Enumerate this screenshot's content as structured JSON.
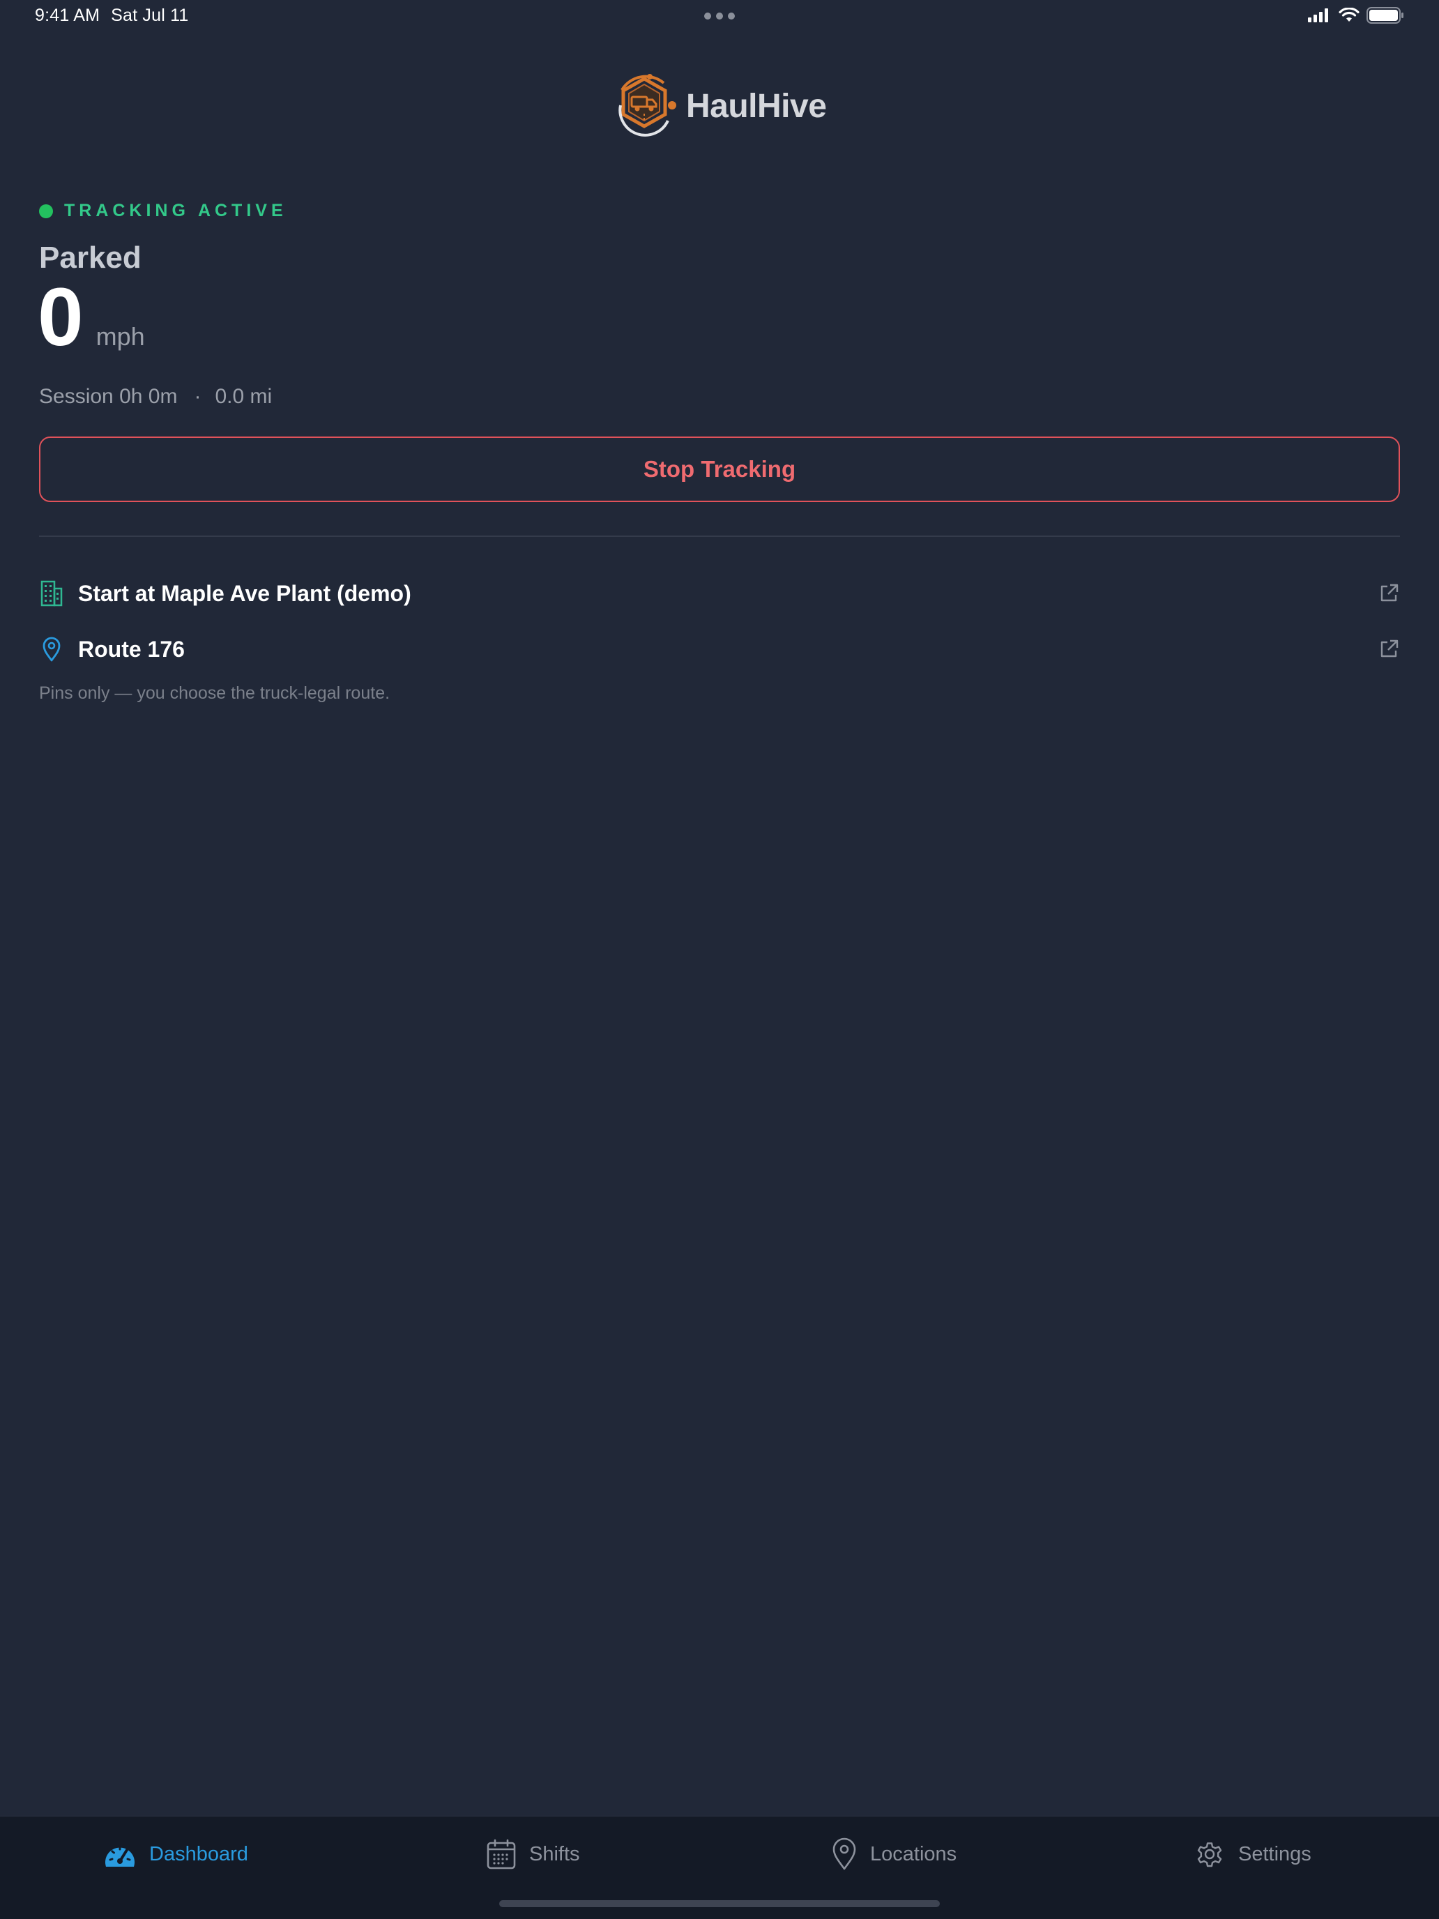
{
  "status_bar": {
    "time": "9:41 AM",
    "date": "Sat Jul 11",
    "icons": [
      "signal-icon",
      "wifi-icon",
      "battery-icon"
    ]
  },
  "brand": {
    "name": "HaulHive",
    "accent_color": "#d8782c"
  },
  "tracking": {
    "status_label": "TRACKING ACTIVE",
    "status_color": "#33c98a",
    "state": "Parked",
    "speed": "0",
    "speed_unit": "mph",
    "session_label": "Session 0h 0m",
    "separator": "·",
    "distance": "0.0 mi",
    "stop_button_label": "Stop Tracking",
    "stop_button_color": "#ef6b70"
  },
  "destinations": {
    "items": [
      {
        "icon": "building-icon",
        "label": "Start at Maple Ave Plant (demo)",
        "action_icon": "external-link-icon"
      },
      {
        "icon": "map-pin-icon",
        "label": "Route 176",
        "action_icon": "external-link-icon"
      }
    ],
    "hint": "Pins only — you choose the truck-legal route."
  },
  "tab_bar": {
    "active_color": "#2a9bdf",
    "tabs": [
      {
        "label": "Dashboard",
        "icon": "speedometer-icon",
        "active": true
      },
      {
        "label": "Shifts",
        "icon": "calendar-icon",
        "active": false
      },
      {
        "label": "Locations",
        "icon": "map-pin-icon",
        "active": false
      },
      {
        "label": "Settings",
        "icon": "gear-icon",
        "active": false
      }
    ]
  }
}
